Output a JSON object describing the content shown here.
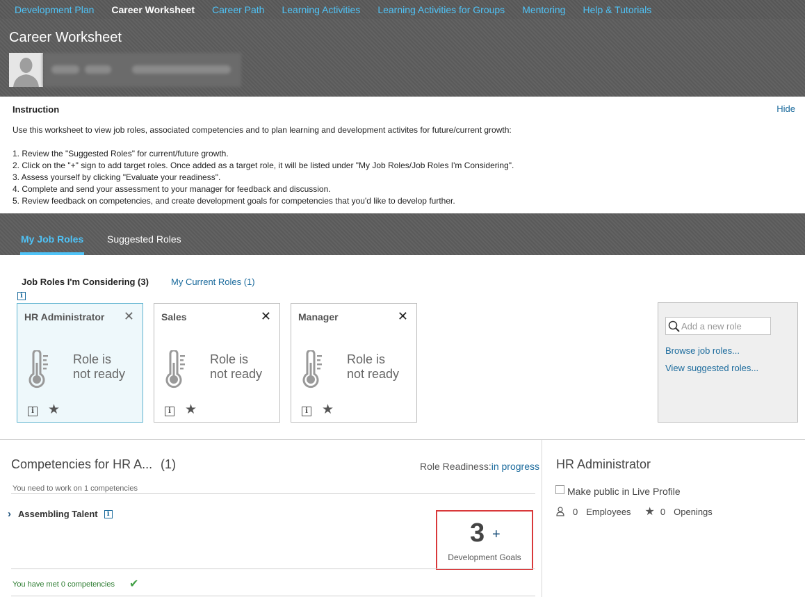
{
  "topnav": {
    "items": [
      "Development Plan",
      "Career Worksheet",
      "Career Path",
      "Learning Activities",
      "Learning Activities for Groups",
      "Mentoring",
      "Help & Tutorials"
    ],
    "active_index": 1
  },
  "header": {
    "title": "Career Worksheet"
  },
  "instruction": {
    "title": "Instruction",
    "hide_label": "Hide",
    "intro": "Use this worksheet to view job roles, associated competencies and to plan learning and development activites for future/current growth:",
    "steps": [
      "1. Review the \"Suggested Roles\" for current/future growth.",
      "2. Click on the \"+\" sign to add target roles. Once added as a target role, it will be listed under \"My Job Roles/Job Roles I'm Considering\".",
      "3. Assess yourself by clicking \"Evaluate your readiness\".",
      "4. Complete and send your assessment to your manager for feedback and discussion.",
      "5. Review feedback on competencies, and create development goals for competencies that you'd like to develop further."
    ]
  },
  "tabs": {
    "my_job_roles": "My Job Roles",
    "suggested_roles": "Suggested Roles"
  },
  "subtabs": {
    "considering": "Job Roles I'm Considering (3)",
    "current": "My Current Roles (1)"
  },
  "roles": [
    {
      "title": "HR Administrator",
      "status_line1": "Role is",
      "status_line2": "not ready"
    },
    {
      "title": "Sales",
      "status_line1": "Role is",
      "status_line2": "not ready"
    },
    {
      "title": "Manager",
      "status_line1": "Role is",
      "status_line2": "not ready"
    }
  ],
  "add_role": {
    "placeholder": "Add a new role",
    "browse_label": "Browse job roles...",
    "suggested_label": "View suggested roles..."
  },
  "competencies": {
    "title": "Competencies for HR A...",
    "count": "(1)",
    "readiness_label": "Role Readiness:",
    "readiness_value": "in progress",
    "need_work": "You need to work on 1 competencies",
    "item_name": "Assembling Talent",
    "goal_count": "3",
    "goal_plus": "+",
    "goal_label": "Development Goals",
    "met": "You have met 0 competencies"
  },
  "right_panel": {
    "title": "HR Administrator",
    "make_public": "Make public in Live Profile",
    "employees_count": "0",
    "employees_label": "Employees",
    "openings_count": "0",
    "openings_label": "Openings"
  },
  "colors": {
    "accent": "#4fc3f7",
    "link": "#1a6a9c",
    "highlight_border": "#d9383a",
    "success": "#43a047"
  }
}
